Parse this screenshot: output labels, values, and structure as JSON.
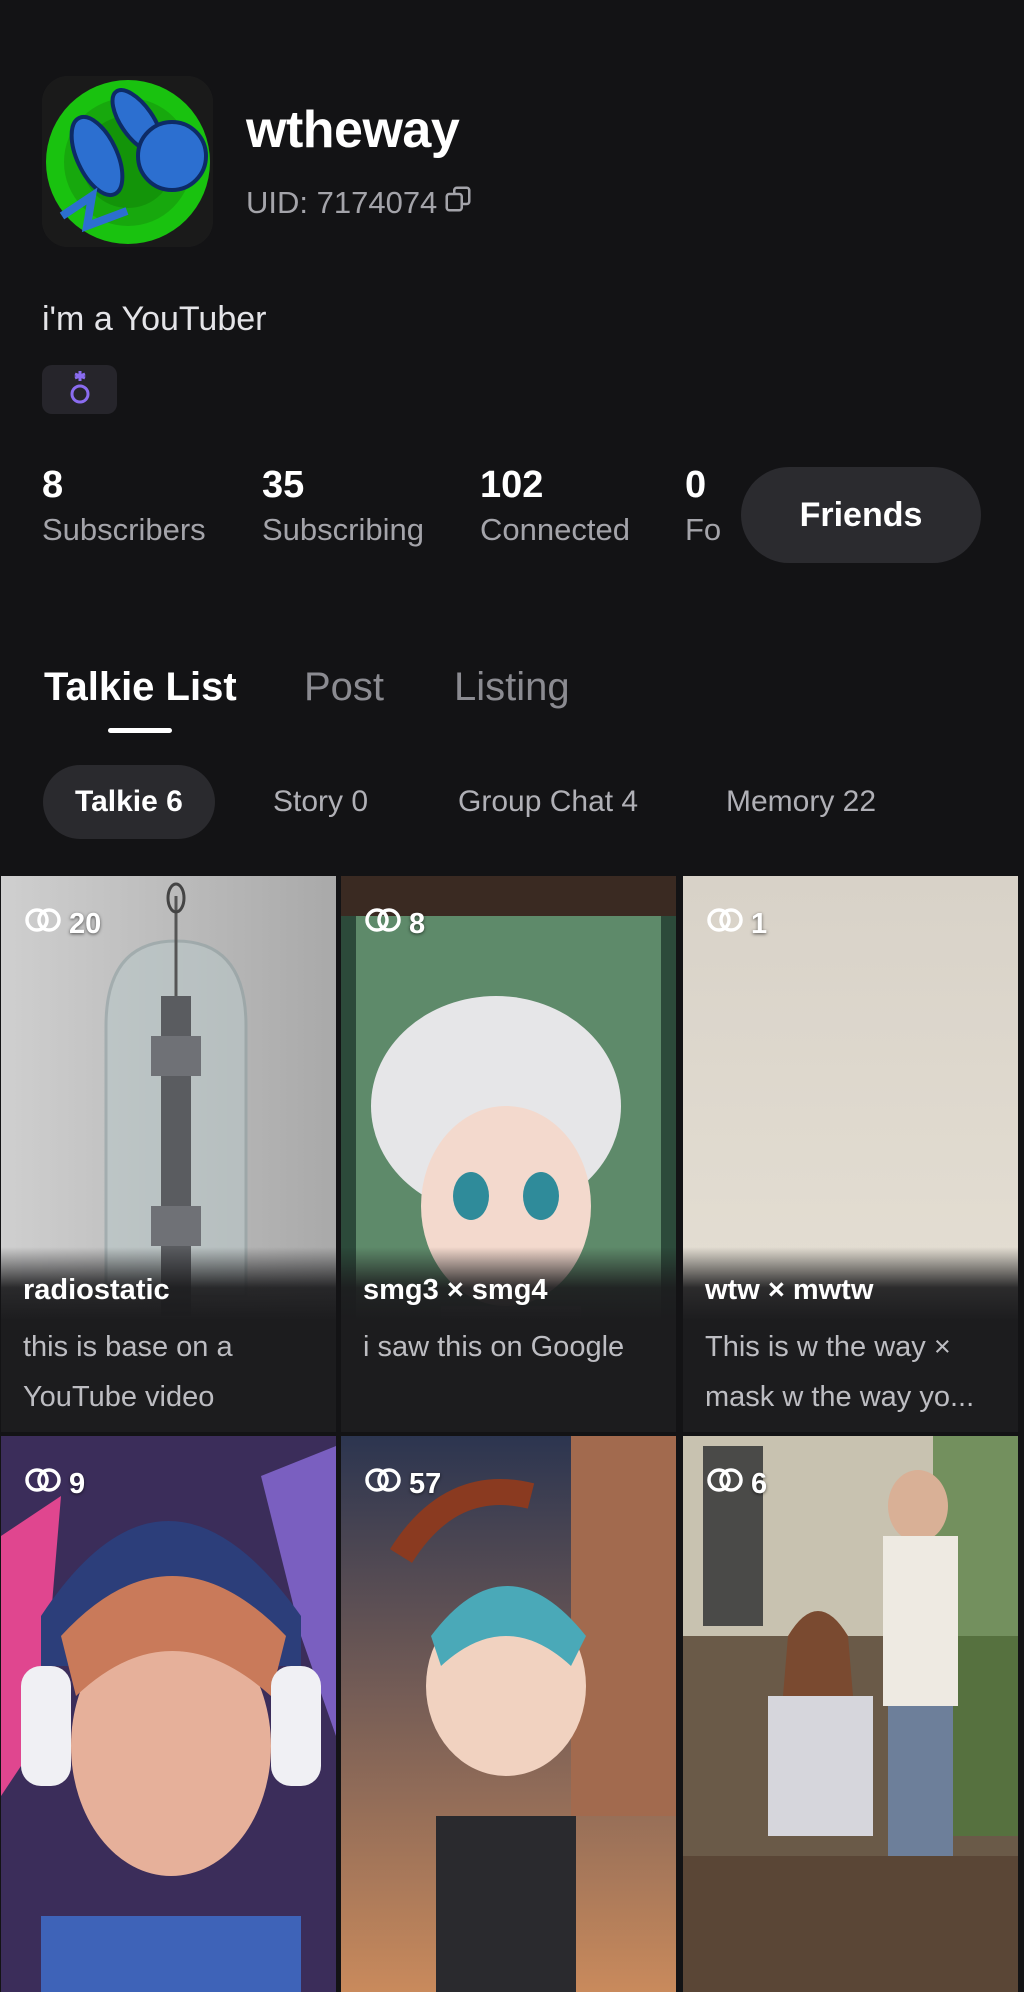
{
  "profile": {
    "username": "wtheway",
    "uid_label": "UID: 7174074",
    "bio": "i'm a YouTuber",
    "badge_icon": "gender-icon"
  },
  "stats": [
    {
      "value": "8",
      "label": "Subscribers"
    },
    {
      "value": "35",
      "label": "Subscribing"
    },
    {
      "value": "102",
      "label": "Connected"
    },
    {
      "value": "0",
      "label": "Fo"
    }
  ],
  "friends_button": "Friends",
  "tabs": [
    {
      "label": "Talkie List",
      "active": true
    },
    {
      "label": "Post",
      "active": false
    },
    {
      "label": "Listing",
      "active": false
    }
  ],
  "subtabs": [
    {
      "label": "Talkie 6",
      "active": true
    },
    {
      "label": "Story 0",
      "active": false
    },
    {
      "label": "Group Chat 4",
      "active": false
    },
    {
      "label": "Memory 22",
      "active": false
    }
  ],
  "cards": [
    {
      "count": "20",
      "title": "radiostatic",
      "desc": "this is base on a YouTube video"
    },
    {
      "count": "8",
      "title": "smg3 × smg4",
      "desc": "i saw this on Google"
    },
    {
      "count": "1",
      "title": "wtw × mwtw",
      "desc": "This is w the way × mask w the way yo..."
    },
    {
      "count": "9",
      "title": "",
      "desc": ""
    },
    {
      "count": "57",
      "title": "",
      "desc": ""
    },
    {
      "count": "6",
      "title": "",
      "desc": ""
    }
  ],
  "colors": {
    "background": "#131315",
    "secondary_text": "#a4a4aa",
    "button_bg": "#2b2b2f",
    "badge_icon": "#8a6cf0"
  }
}
